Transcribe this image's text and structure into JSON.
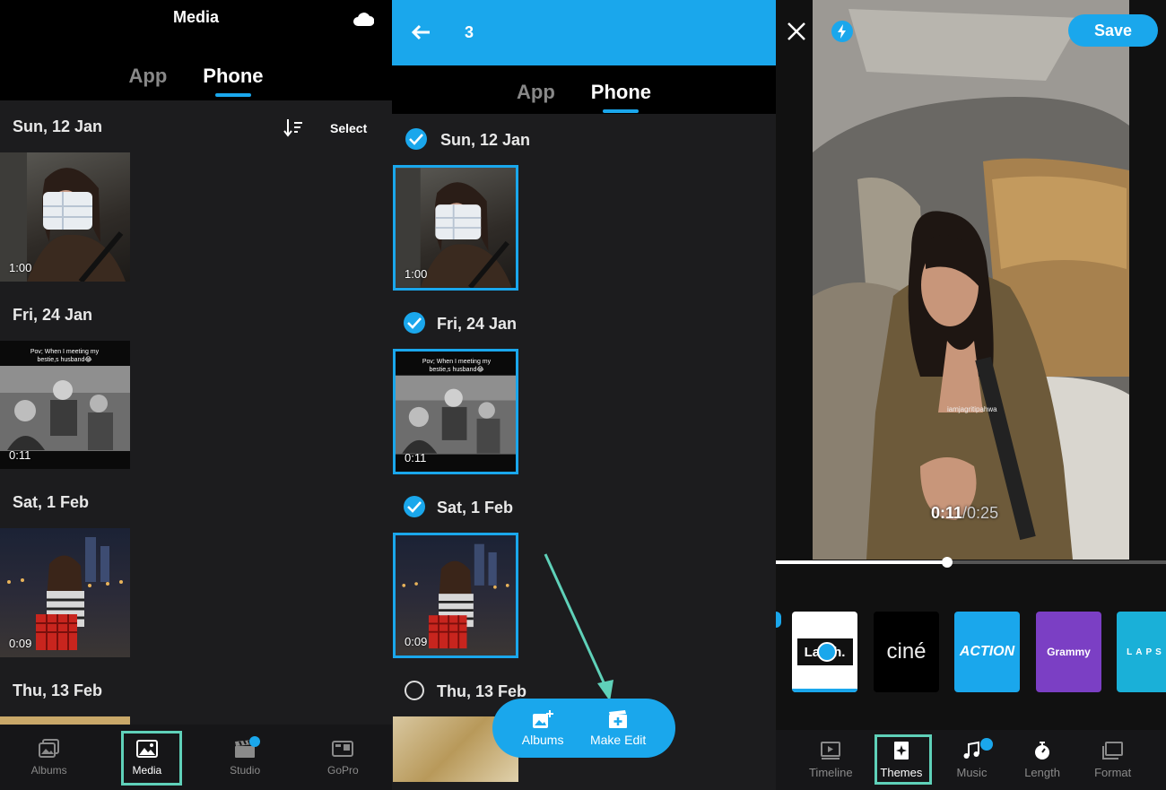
{
  "panel1": {
    "title": "Media",
    "tabs": [
      {
        "label": "App"
      },
      {
        "label": "Phone"
      }
    ],
    "sort_icon": "sort-descending-icon",
    "select_label": "Select",
    "sections": [
      {
        "date": "Sun, 12 Jan",
        "duration": "1:00"
      },
      {
        "date": "Fri, 24 Jan",
        "duration": "0:11",
        "caption": "Pov; When I meeting my bestie,s husband😂"
      },
      {
        "date": "Sat, 1 Feb",
        "duration": "0:09"
      },
      {
        "date": "Thu, 13 Feb"
      }
    ],
    "nav": [
      {
        "label": "Albums",
        "icon": "albums-icon"
      },
      {
        "label": "Media",
        "icon": "image-icon"
      },
      {
        "label": "Studio",
        "icon": "clapperboard-icon"
      },
      {
        "label": "GoPro",
        "icon": "camera-icon"
      }
    ]
  },
  "panel2": {
    "selected_count": "3",
    "tabs": [
      {
        "label": "App"
      },
      {
        "label": "Phone"
      }
    ],
    "sections": [
      {
        "date": "Sun, 12 Jan",
        "duration": "1:00",
        "selected": true
      },
      {
        "date": "Fri, 24 Jan",
        "duration": "0:11",
        "selected": true,
        "caption": "Pov; When I meeting my bestie,s husband😂"
      },
      {
        "date": "Sat, 1 Feb",
        "duration": "0:09",
        "selected": true
      },
      {
        "date": "Thu, 13 Feb",
        "selected": false
      }
    ],
    "fab": [
      {
        "label": "Albums",
        "icon": "add-album-icon"
      },
      {
        "label": "Make Edit",
        "icon": "make-edit-icon"
      }
    ]
  },
  "panel3": {
    "save_label": "Save",
    "time_current": "0:11",
    "time_total": "/0:25",
    "progress": 0.44,
    "watermark": "iamjagritipahwa",
    "themes": [
      {
        "label": "La…h.",
        "color": "#ffffff"
      },
      {
        "label": "ciné",
        "color": "#000000"
      },
      {
        "label": "ACTION",
        "color": "#1aa7ec"
      },
      {
        "label": "Grammy",
        "color": "#7b3fc4"
      },
      {
        "label": "LAPS",
        "color": "#1ab0d8"
      }
    ],
    "nav": [
      {
        "label": "Timeline",
        "icon": "timeline-icon"
      },
      {
        "label": "Themes",
        "icon": "themes-icon"
      },
      {
        "label": "Music",
        "icon": "music-note-icon"
      },
      {
        "label": "Length",
        "icon": "stopwatch-icon"
      },
      {
        "label": "Format",
        "icon": "format-icon"
      }
    ]
  },
  "colors": {
    "accent": "#1aa7ec",
    "highlight": "#5fd1b9"
  }
}
